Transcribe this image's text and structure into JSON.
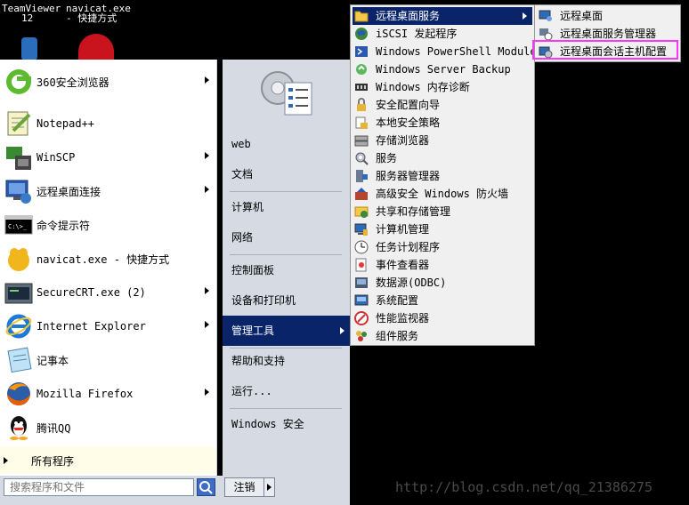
{
  "desktop": {
    "teamviewer_label": "TeamViewer",
    "teamviewer_sub": "12",
    "navicat_label": "navicat.exe",
    "navicat_sub": "- 快捷方式"
  },
  "pinned_programs": [
    {
      "label": "360安全浏览器",
      "icon": "360-browser-icon",
      "has_arrow": true
    },
    {
      "label": "Notepad++",
      "icon": "notepadpp-icon",
      "has_arrow": false
    },
    {
      "label": "WinSCP",
      "icon": "winscp-icon",
      "has_arrow": true
    },
    {
      "label": "远程桌面连接",
      "icon": "remote-desktop-icon",
      "has_arrow": true
    },
    {
      "label": "命令提示符",
      "icon": "cmd-icon",
      "has_arrow": false
    },
    {
      "label": "navicat.exe - 快捷方式",
      "icon": "navicat-icon",
      "has_arrow": false
    },
    {
      "label": "SecureCRT.exe (2)",
      "icon": "securecrt-icon",
      "has_arrow": true
    },
    {
      "label": "Internet Explorer",
      "icon": "ie-icon",
      "has_arrow": true
    },
    {
      "label": "记事本",
      "icon": "notepad-icon",
      "has_arrow": false
    },
    {
      "label": "Mozilla Firefox",
      "icon": "firefox-icon",
      "has_arrow": true
    },
    {
      "label": "腾讯QQ",
      "icon": "qq-icon",
      "has_arrow": false
    }
  ],
  "all_programs_label": "所有程序",
  "search": {
    "placeholder": "搜索程序和文件"
  },
  "right_pane": {
    "items": [
      {
        "label": "web"
      },
      {
        "label": "文档"
      },
      {
        "label": "计算机"
      },
      {
        "label": "网络"
      },
      {
        "label": "控制面板"
      },
      {
        "label": "设备和打印机"
      },
      {
        "label": "管理工具"
      },
      {
        "label": "帮助和支持"
      },
      {
        "label": "运行..."
      },
      {
        "label": "Windows 安全"
      }
    ],
    "selected": "管理工具",
    "logoff_label": "注销"
  },
  "admin_tools": [
    {
      "label": "远程桌面服务",
      "icon": "folder-icon"
    },
    {
      "label": "iSCSI 发起程序",
      "icon": "globe-icon"
    },
    {
      "label": "Windows PowerShell Modules",
      "icon": "powershell-icon"
    },
    {
      "label": "Windows Server Backup",
      "icon": "backup-icon"
    },
    {
      "label": "Windows 内存诊断",
      "icon": "memory-icon"
    },
    {
      "label": "安全配置向导",
      "icon": "security-wizard-icon"
    },
    {
      "label": "本地安全策略",
      "icon": "security-policy-icon"
    },
    {
      "label": "存储浏览器",
      "icon": "storage-icon"
    },
    {
      "label": "服务",
      "icon": "services-icon"
    },
    {
      "label": "服务器管理器",
      "icon": "server-manager-icon"
    },
    {
      "label": "高级安全 Windows 防火墙",
      "icon": "firewall-icon"
    },
    {
      "label": "共享和存储管理",
      "icon": "share-storage-icon"
    },
    {
      "label": "计算机管理",
      "icon": "computer-mgmt-icon"
    },
    {
      "label": "任务计划程序",
      "icon": "clock-icon"
    },
    {
      "label": "事件查看器",
      "icon": "event-viewer-icon"
    },
    {
      "label": "数据源(ODBC)",
      "icon": "odbc-icon"
    },
    {
      "label": "系统配置",
      "icon": "sysconfig-icon"
    },
    {
      "label": "性能监视器",
      "icon": "perfmon-icon"
    },
    {
      "label": "组件服务",
      "icon": "component-icon"
    }
  ],
  "rds_menu": [
    {
      "label": "远程桌面",
      "icon": "remote-desktop-icon"
    },
    {
      "label": "远程桌面服务管理器",
      "icon": "rds-manager-icon"
    },
    {
      "label": "远程桌面会话主机配置",
      "icon": "rds-host-config-icon"
    }
  ],
  "highlight_color": "#ff33ff",
  "selection_color": "#0a246a",
  "watermark": "http://blog.csdn.net/qq_21386275"
}
